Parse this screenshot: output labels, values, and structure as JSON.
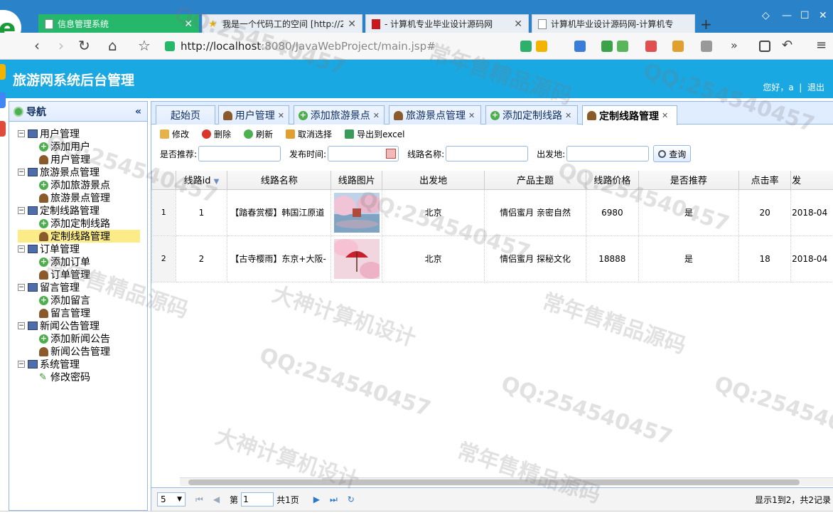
{
  "browser": {
    "tabs": [
      {
        "title": "信息管理系统",
        "active": true
      },
      {
        "title": "我是一个代码工的空间 [http://2",
        "active": false
      },
      {
        "title": "- 计算机专业毕业设计源码网",
        "active": false
      },
      {
        "title": "计算机毕业设计源码网-计算机专",
        "active": false
      }
    ],
    "url_host": "http://localhost",
    "url_rest": ":8080/JavaWebProject/main.jsp#"
  },
  "app": {
    "title": "旅游网系统后台管理",
    "greeting": "您好，a",
    "logout": "退出"
  },
  "nav": {
    "title": "导航",
    "collapse": "«",
    "groups": [
      {
        "label": "用户管理",
        "items": [
          {
            "label": "添加用户",
            "icon": "add"
          },
          {
            "label": "用户管理",
            "icon": "user"
          }
        ]
      },
      {
        "label": "旅游景点管理",
        "items": [
          {
            "label": "添加旅游景点",
            "icon": "add"
          },
          {
            "label": "旅游景点管理",
            "icon": "user"
          }
        ]
      },
      {
        "label": "定制线路管理",
        "items": [
          {
            "label": "添加定制线路",
            "icon": "add"
          },
          {
            "label": "定制线路管理",
            "icon": "user",
            "selected": true
          }
        ]
      },
      {
        "label": "订单管理",
        "items": [
          {
            "label": "添加订单",
            "icon": "add"
          },
          {
            "label": "订单管理",
            "icon": "user"
          }
        ]
      },
      {
        "label": "留言管理",
        "items": [
          {
            "label": "添加留言",
            "icon": "add"
          },
          {
            "label": "留言管理",
            "icon": "user"
          }
        ]
      },
      {
        "label": "新闻公告管理",
        "items": [
          {
            "label": "添加新闻公告",
            "icon": "add"
          },
          {
            "label": "新闻公告管理",
            "icon": "user"
          }
        ]
      },
      {
        "label": "系统管理",
        "items": [
          {
            "label": "修改密码",
            "icon": "pen"
          }
        ]
      }
    ]
  },
  "tabs": [
    {
      "label": "起始页",
      "closable": false
    },
    {
      "label": "用户管理",
      "closable": true,
      "icon": "user"
    },
    {
      "label": "添加旅游景点",
      "closable": true,
      "icon": "add"
    },
    {
      "label": "旅游景点管理",
      "closable": true,
      "icon": "user"
    },
    {
      "label": "添加定制线路",
      "closable": true,
      "icon": "add"
    },
    {
      "label": "定制线路管理",
      "closable": true,
      "icon": "user",
      "active": true
    }
  ],
  "toolbar": {
    "edit": "修改",
    "delete": "删除",
    "refresh": "刷新",
    "cancel_select": "取消选择",
    "export": "导出到excel"
  },
  "search": {
    "recommend_label": "是否推荐:",
    "publish_time_label": "发布时间:",
    "route_name_label": "线路名称:",
    "departure_label": "出发地:",
    "query": "查询"
  },
  "grid": {
    "columns": [
      "线路id",
      "线路名称",
      "线路图片",
      "出发地",
      "产品主题",
      "线路价格",
      "是否推荐",
      "点击率",
      "发"
    ],
    "rows": [
      {
        "rownum": "1",
        "id": "1",
        "name": "【踏春赏樱】韩国江原道",
        "departure": "北京",
        "theme": "情侣蜜月 亲密自然",
        "price": "6980",
        "recommend": "是",
        "clicks": "20",
        "date": "2018-04"
      },
      {
        "rownum": "2",
        "id": "2",
        "name": "【古寺樱雨】东京+大阪-",
        "departure": "北京",
        "theme": "情侣蜜月 探秘文化",
        "price": "18888",
        "recommend": "是",
        "clicks": "18",
        "date": "2018-04"
      }
    ]
  },
  "pager": {
    "page_size": "5",
    "page_prefix": "第",
    "page_value": "1",
    "page_total": "共1页",
    "info": "显示1到2，共2记录"
  },
  "watermarks": [
    "QQ:254540457",
    "常年售精品源码",
    "大神计算机设计"
  ],
  "colors": {
    "header": "#1aa8e2",
    "browser_tabstrip": "#2a82c9",
    "active_tab": "#25b86b",
    "panel_border": "#95b8e7",
    "selected_node": "#fbec88"
  }
}
